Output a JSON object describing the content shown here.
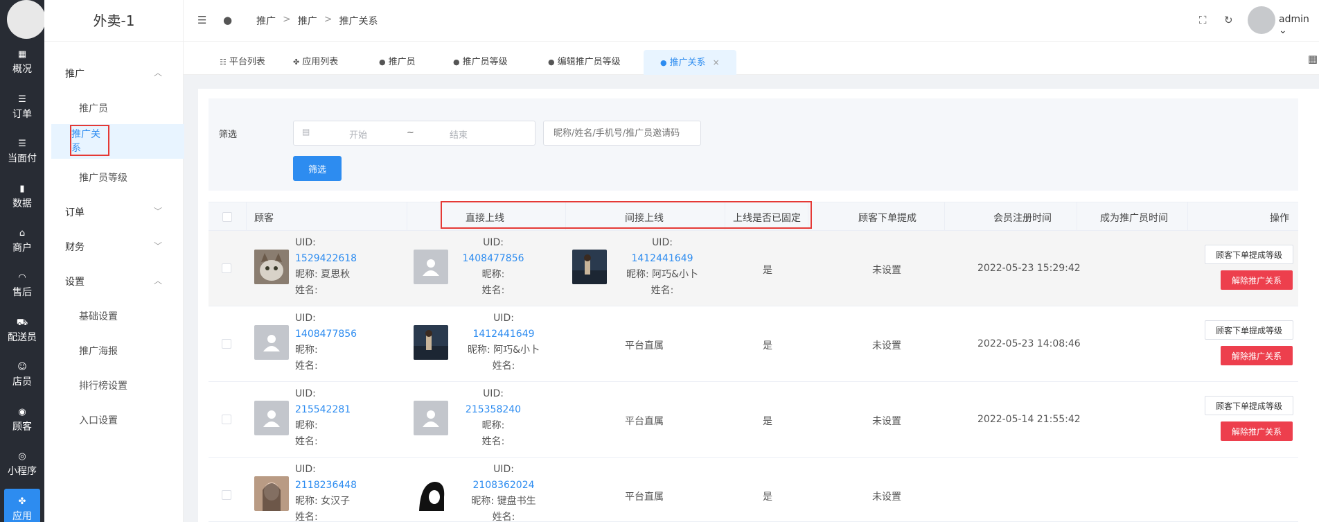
{
  "rail": {
    "items": [
      {
        "label": "概况",
        "icon": "dashboard-icon"
      },
      {
        "label": "订单",
        "icon": "list-icon"
      },
      {
        "label": "当面付",
        "icon": "list-icon"
      },
      {
        "label": "数据",
        "icon": "bar-chart-icon"
      },
      {
        "label": "商户",
        "icon": "store-icon"
      },
      {
        "label": "售后",
        "icon": "headset-icon"
      },
      {
        "label": "配送员",
        "icon": "delivery-icon"
      },
      {
        "label": "店员",
        "icon": "users-icon"
      },
      {
        "label": "顾客",
        "icon": "user-icon"
      },
      {
        "label": "小程序",
        "icon": "wechat-icon"
      },
      {
        "label": "应用",
        "icon": "apps-icon"
      }
    ]
  },
  "side": {
    "title": "外卖-1",
    "groups": {
      "promo": "推广",
      "order": "订单",
      "finance": "财务",
      "settings": "设置"
    },
    "subs": {
      "promoter": "推广员",
      "relation": "推广关系",
      "level": "推广员等级",
      "basic": "基础设置",
      "poster": "推广海报",
      "rank": "排行榜设置",
      "entry": "入口设置"
    }
  },
  "header": {
    "crumbs": [
      "推广",
      "推广",
      "推广关系"
    ],
    "crumb_sep": ">",
    "user": "admin"
  },
  "tabs": [
    {
      "label": "平台列表"
    },
    {
      "label": "应用列表"
    },
    {
      "label": "推广员"
    },
    {
      "label": "推广员等级"
    },
    {
      "label": "编辑推广员等级"
    },
    {
      "label": "推广关系",
      "close": "×"
    }
  ],
  "filter": {
    "label": "筛选",
    "start_placeholder": "开始",
    "tilde": "~",
    "end_placeholder": "结束",
    "search_placeholder": "昵称/姓名/手机号/推广员邀请码",
    "button": "筛选"
  },
  "table": {
    "headers": {
      "customer": "顾客",
      "direct": "直接上线",
      "indirect": "间接上线",
      "fixed": "上线是否已固定",
      "commission": "顾客下单提成",
      "reg_time": "会员注册时间",
      "promoter_time": "成为推广员时间",
      "ops": "操作"
    },
    "labels": {
      "uid": "UID:",
      "nick": "昵称:",
      "name": "姓名:"
    },
    "buttons": {
      "level": "顾客下单提成等级",
      "unbind": "解除推广关系"
    },
    "rows": [
      {
        "customer": {
          "uid": "1529422618",
          "nick": "夏思秋",
          "name": ""
        },
        "direct": {
          "uid": "1408477856",
          "nick": "",
          "name": ""
        },
        "indirect": {
          "uid": "1412441649",
          "nick": "阿巧&小卜",
          "name": ""
        },
        "fixed": "是",
        "commission": "未设置",
        "reg_time": "2022-05-23 15:29:42",
        "promoter_time": ""
      },
      {
        "customer": {
          "uid": "1408477856",
          "nick": "",
          "name": ""
        },
        "direct": {
          "uid": "1412441649",
          "nick": "阿巧&小卜",
          "name": ""
        },
        "indirect_text": "平台直属",
        "fixed": "是",
        "commission": "未设置",
        "reg_time": "2022-05-23 14:08:46",
        "promoter_time": ""
      },
      {
        "customer": {
          "uid": "215542281",
          "nick": "",
          "name": ""
        },
        "direct": {
          "uid": "215358240",
          "nick": "",
          "name": ""
        },
        "indirect_text": "平台直属",
        "fixed": "是",
        "commission": "未设置",
        "reg_time": "2022-05-14 21:55:42",
        "promoter_time": ""
      },
      {
        "customer": {
          "uid": "2118236448",
          "nick": "女汉子",
          "name": ""
        },
        "direct": {
          "uid": "2108362024",
          "nick": "键盘书生",
          "name": ""
        },
        "indirect_text": "平台直属",
        "fixed": "是",
        "commission": "未设置",
        "reg_time": "",
        "promoter_time": ""
      }
    ]
  },
  "colors": {
    "primary": "#2d8cf0",
    "danger": "#ed3f4d",
    "rail": "#282c34",
    "highlight_box": "#e53935"
  }
}
